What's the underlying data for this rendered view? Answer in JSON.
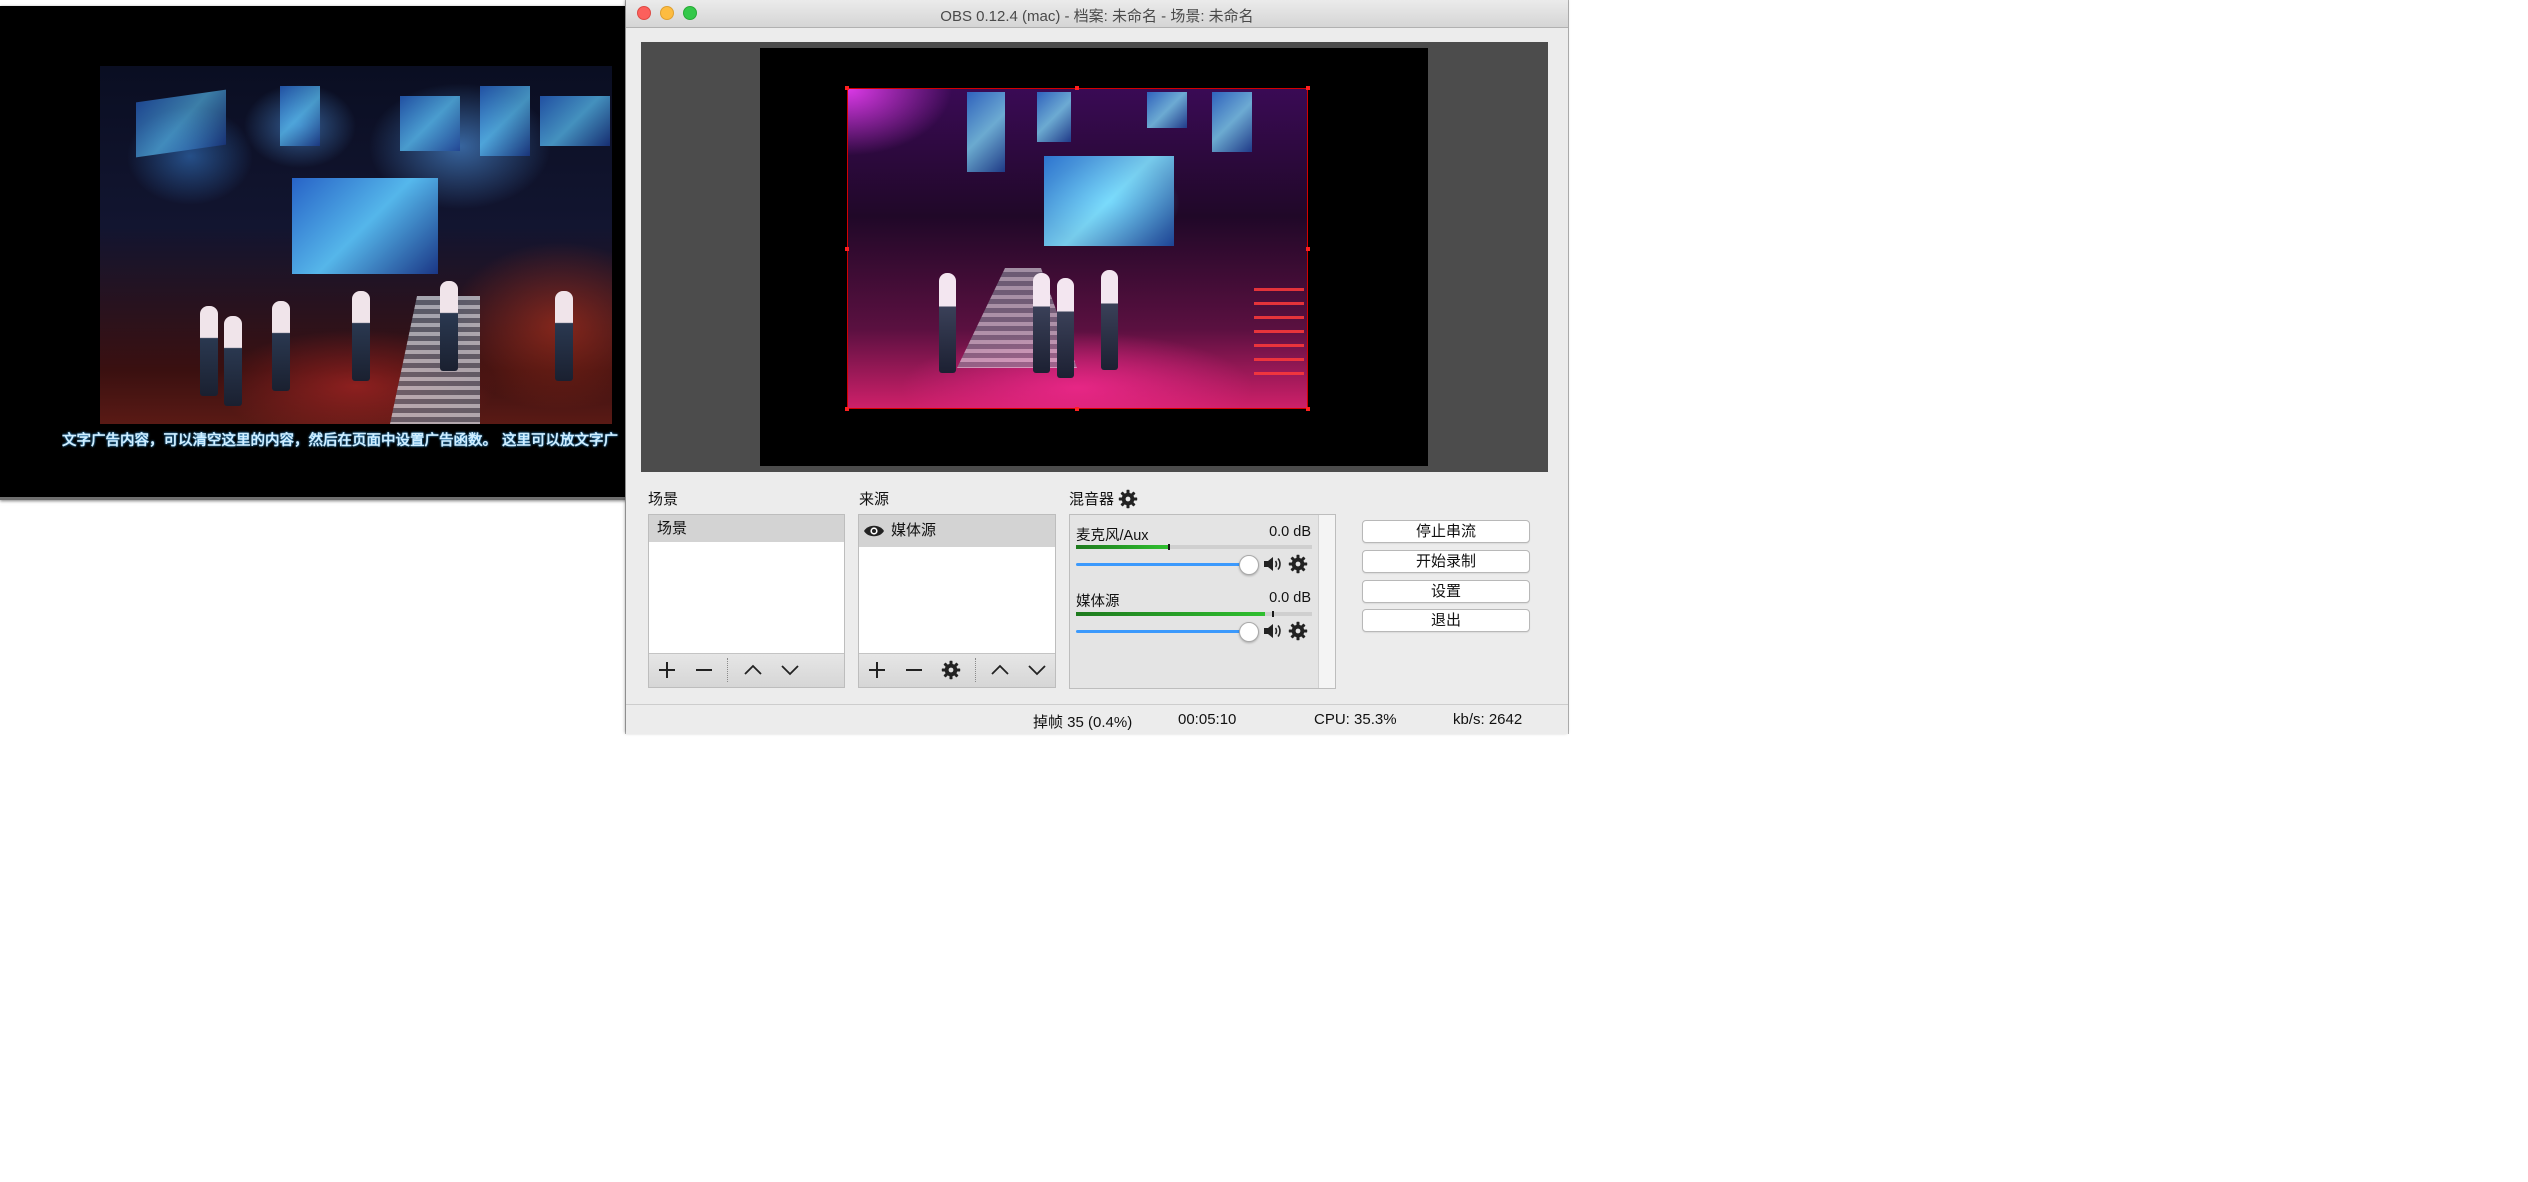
{
  "player": {
    "marquee_text": "文字广告内容，可以清空这里的内容，然后在页面中设置广告函数。  这里可以放文字广"
  },
  "obs": {
    "window_title": "OBS 0.12.4 (mac) - 档案: 未命名 - 场景: 未命名",
    "scenes": {
      "title": "场景",
      "items": [
        "场景"
      ]
    },
    "sources": {
      "title": "来源",
      "items": [
        "媒体源"
      ]
    },
    "mixer": {
      "title": "混音器",
      "channels": [
        {
          "name": "麦克风/Aux",
          "db": "0.0 dB",
          "level": 0.39
        },
        {
          "name": "媒体源",
          "db": "0.0 dB",
          "level": 0.8
        }
      ]
    },
    "controls": {
      "stop_stream": "停止串流",
      "start_record": "开始录制",
      "settings": "设置",
      "exit": "退出"
    },
    "status": {
      "dropped": "掉帧 35 (0.4%)",
      "time": "00:05:10",
      "cpu": "CPU: 35.3%",
      "kbps": "kb/s: 2642"
    },
    "colors": {
      "accent_slider": "#3b99fc",
      "selection_border": "#d40000",
      "meter_green": "#2fbf2f"
    }
  }
}
